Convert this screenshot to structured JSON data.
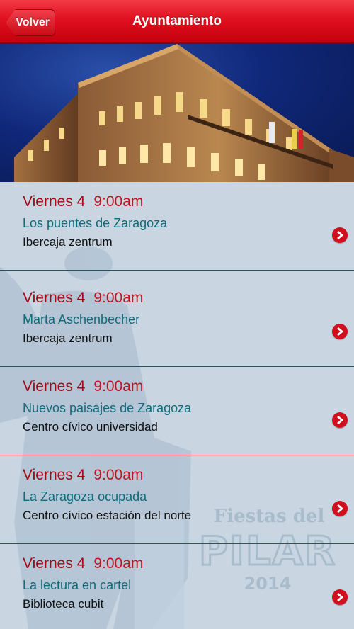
{
  "navbar": {
    "back_label": "Volver",
    "title": "Ayuntamiento"
  },
  "events": [
    {
      "day": "Viernes 4",
      "time": "9:00am",
      "title": "Los puentes de Zaragoza",
      "place": "Ibercaja zentrum"
    },
    {
      "day": "Viernes 4",
      "time": "9:00am",
      "title": "Marta Aschenbecher",
      "place": "Ibercaja zentrum"
    },
    {
      "day": "Viernes 4",
      "time": "9:00am",
      "title": "Nuevos paisajes de Zaragoza",
      "place": "Centro cívico universidad"
    },
    {
      "day": "Viernes 4",
      "time": "9:00am",
      "title": "La Zaragoza ocupada",
      "place": "Centro cívico estación del norte"
    },
    {
      "day": "Viernes 4",
      "time": "9:00am",
      "title": "La lectura en cartel",
      "place": "Biblioteca cubit"
    }
  ],
  "watermark": {
    "line1": "Fiestas del",
    "line2": "PILAR",
    "line3": "2014"
  },
  "colors": {
    "navbar": "#e0101f",
    "accent": "#c8101c",
    "title_text": "#0e6b79",
    "list_bg": "#c9d6e2"
  },
  "icons": {
    "row_action": "chevron-right-circle-icon"
  }
}
